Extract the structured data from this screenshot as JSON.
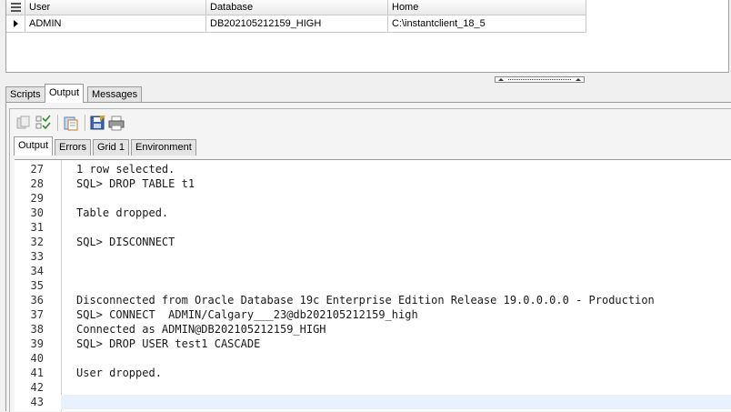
{
  "connections": {
    "columns": [
      "User",
      "Database",
      "Home"
    ],
    "rows": [
      {
        "user": "ADMIN",
        "database": "DB202105212159_HIGH",
        "home": "C:\\instantclient_18_5"
      }
    ]
  },
  "outer_tabs": [
    "Scripts",
    "Output",
    "Messages"
  ],
  "outer_active_tab": "Output",
  "toolbar_icons": [
    "copy-icon",
    "check-list-icon",
    "clipboard-icon",
    "save-icon",
    "print-icon"
  ],
  "inner_tabs": [
    "Output",
    "Errors",
    "Grid 1",
    "Environment"
  ],
  "inner_active_tab": "Output",
  "output_lines": [
    {
      "n": "27",
      "text": "1 row selected."
    },
    {
      "n": "28",
      "text": "SQL> DROP TABLE t1"
    },
    {
      "n": "29",
      "text": ""
    },
    {
      "n": "30",
      "text": "Table dropped."
    },
    {
      "n": "31",
      "text": ""
    },
    {
      "n": "32",
      "text": "SQL> DISCONNECT"
    },
    {
      "n": "33",
      "text": ""
    },
    {
      "n": "34",
      "text": ""
    },
    {
      "n": "35",
      "text": ""
    },
    {
      "n": "36",
      "text": "Disconnected from Oracle Database 19c Enterprise Edition Release 19.0.0.0.0 - Production"
    },
    {
      "n": "37",
      "text": "SQL> CONNECT  ADMIN/Calgary___23@db202105212159_high"
    },
    {
      "n": "38",
      "text": "Connected as ADMIN@DB202105212159_HIGH"
    },
    {
      "n": "39",
      "text": "SQL> DROP USER test1 CASCADE"
    },
    {
      "n": "40",
      "text": ""
    },
    {
      "n": "41",
      "text": "User dropped."
    },
    {
      "n": "42",
      "text": ""
    },
    {
      "n": "43",
      "text": ""
    }
  ],
  "current_line": "43",
  "colors": {
    "current_line_bg": "#e8f2fe",
    "panel_bg": "#f0f0f0"
  }
}
